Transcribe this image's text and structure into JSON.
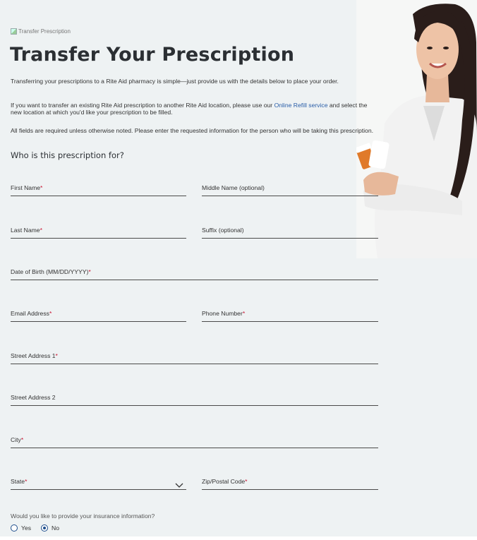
{
  "hero": {
    "image_alt": "Transfer Prescription"
  },
  "page_title": "Transfer Your Prescription",
  "intro": "Transferring your prescriptions to a Rite Aid pharmacy is simple—just provide us with the details below to place your order.",
  "refill_note": {
    "before": "If you want to transfer an existing Rite Aid prescription to another Rite Aid location, please use our ",
    "link": "Online Refill service",
    "after": " and select the new location at which you'd like your prescription to be filled."
  },
  "required_note": "All fields are required unless otherwise noted. Please enter the requested information for the person who will be taking this prescription.",
  "section_title": "Who is this prescription for?",
  "fields": {
    "first_name": "First Name",
    "middle_name": "Middle Name (optional)",
    "last_name": "Last Name",
    "suffix": "Suffix (optional)",
    "dob": "Date of Birth (MM/DD/YYYY)",
    "email": "Email Address",
    "phone": "Phone Number",
    "street1": "Street Address 1",
    "street2": "Street Address 2",
    "city": "City",
    "state": "State",
    "zip": "Zip/Postal Code"
  },
  "required_marker": "*",
  "insurance": {
    "question": "Would you like to provide your insurance information?",
    "yes": "Yes",
    "no": "No",
    "selected": "No"
  },
  "colors": {
    "background": "#eef2f3",
    "required": "#c8102e",
    "link": "#2a5ea8",
    "radio": "#1f4e8c"
  }
}
